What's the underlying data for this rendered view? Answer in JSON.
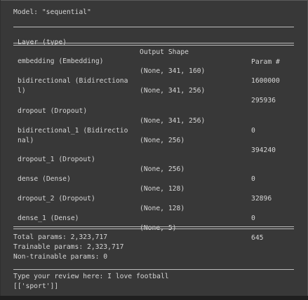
{
  "model_title": "Model: \"sequential\"",
  "headers": [
    "Layer (type)",
    "Output Shape",
    "Param #"
  ],
  "rows": [
    {
      "layer": [
        "embedding (Embedding)"
      ],
      "shape": "(None, 341, 160)",
      "params": "1600000"
    },
    {
      "layer": [
        "bidirectional (Bidirectiona",
        "l)"
      ],
      "shape": "(None, 341, 256)",
      "params": "295936"
    },
    {
      "layer": [
        "dropout (Dropout)"
      ],
      "shape": "(None, 341, 256)",
      "params": "0"
    },
    {
      "layer": [
        "bidirectional_1 (Bidirectio",
        "nal)"
      ],
      "shape": "(None, 256)",
      "params": "394240"
    },
    {
      "layer": [
        "dropout_1 (Dropout)"
      ],
      "shape": "(None, 256)",
      "params": "0"
    },
    {
      "layer": [
        "dense (Dense)"
      ],
      "shape": "(None, 128)",
      "params": "32896"
    },
    {
      "layer": [
        "dropout_2 (Dropout)"
      ],
      "shape": "(None, 128)",
      "params": "0"
    },
    {
      "layer": [
        "dense_1 (Dense)"
      ],
      "shape": "(None, 5)",
      "params": "645"
    }
  ],
  "summary": {
    "total": "Total params: 2,323,717",
    "trainable": "Trainable params: 2,323,717",
    "non_trainable": "Non-trainable params: 0"
  },
  "prompt_line": "Type your review here: I love football",
  "result_line": "[['sport']]",
  "colors": {
    "background": "#383838",
    "text": "#d6d6d6",
    "rule": "#bdbdbd"
  }
}
